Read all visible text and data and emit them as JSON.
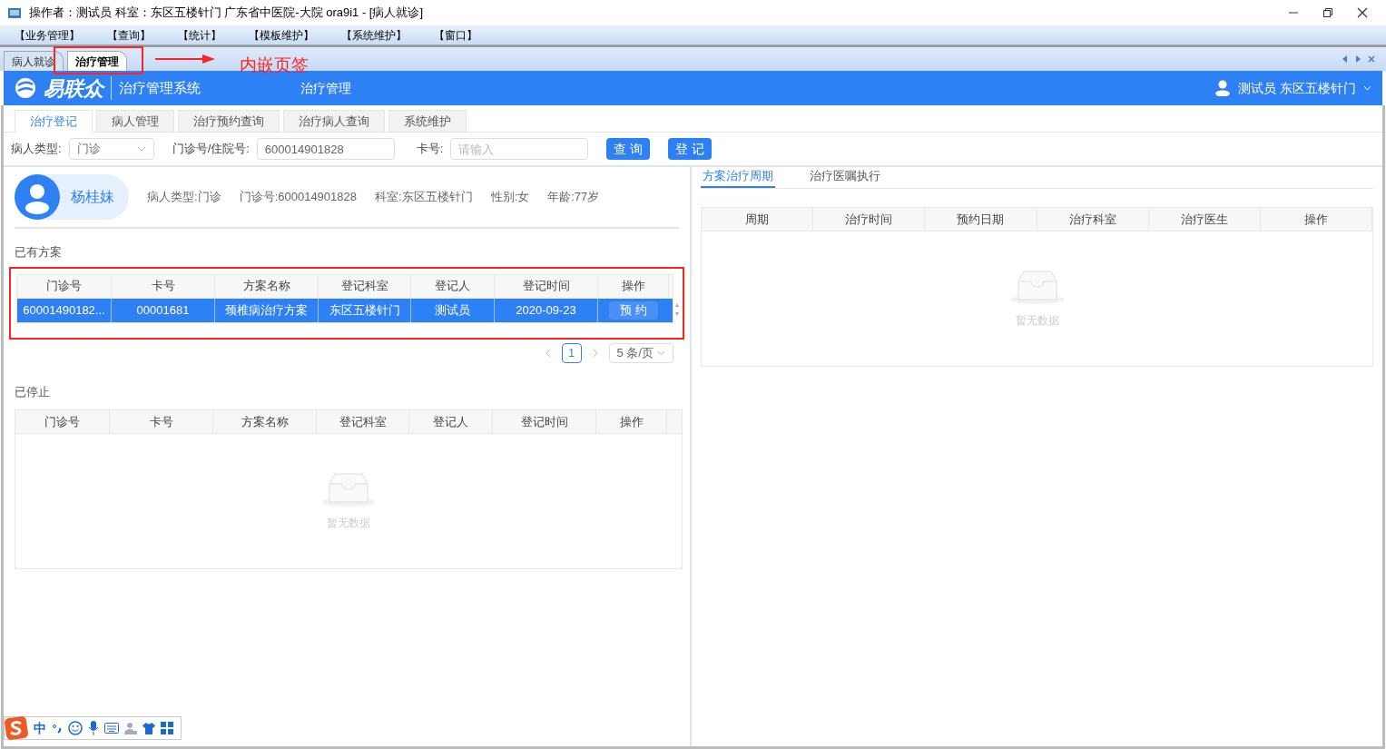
{
  "window": {
    "title": "操作者：测试员  科室：东区五楼针门  广东省中医院-大院 ora9i1 - [病人就诊]"
  },
  "menu": [
    "【业务管理】",
    "【查询】",
    "【统计】",
    "【模板维护】",
    "【系统维护】",
    "【窗口】"
  ],
  "doc_tabs": [
    {
      "label": "病人就诊",
      "selected": false
    },
    {
      "label": "治疗管理",
      "selected": true
    }
  ],
  "annotation": {
    "label": "内嵌页签"
  },
  "header": {
    "logo_text": "易联众",
    "system_name": "治疗管理系统",
    "page_title": "治疗管理",
    "user": "测试员 东区五楼针门"
  },
  "module_tabs": [
    {
      "label": "治疗登记",
      "selected": true
    },
    {
      "label": "病人管理",
      "selected": false
    },
    {
      "label": "治疗预约查询",
      "selected": false
    },
    {
      "label": "治疗病人查询",
      "selected": false
    },
    {
      "label": "系统维护",
      "selected": false
    }
  ],
  "search": {
    "patient_type": {
      "label": "病人类型:",
      "value": "门诊"
    },
    "number": {
      "label": "门诊号/住院号:",
      "value": "600014901828"
    },
    "card": {
      "label": "卡号:",
      "placeholder": "请输入"
    },
    "buttons": [
      "查 询",
      "登 记"
    ]
  },
  "patient": {
    "name": "杨桂妹",
    "info": [
      "病人类型:门诊",
      "门诊号:600014901828",
      "科室:东区五楼针门",
      "性别:女",
      "年龄:77岁"
    ]
  },
  "active_plans": {
    "title": "已有方案",
    "columns": [
      "门诊号",
      "卡号",
      "方案名称",
      "登记科室",
      "登记人",
      "登记时间",
      "操作"
    ],
    "rows": [
      {
        "selected": true,
        "cells": [
          "60001490182...",
          "00001681",
          "颈椎病治疗方案",
          "东区五楼针门",
          "测试员",
          "2020-09-23"
        ],
        "action": "预 约"
      }
    ],
    "pagination": {
      "page": "1",
      "page_size": "5 条/页"
    }
  },
  "stopped_plans": {
    "title": "已停止",
    "columns": [
      "门诊号",
      "卡号",
      "方案名称",
      "登记科室",
      "登记人",
      "登记时间",
      "操作"
    ],
    "empty_text": "暂无数据"
  },
  "right_panel": {
    "tabs": [
      {
        "label": "方案治疗周期",
        "selected": true
      },
      {
        "label": "治疗医嘱执行",
        "selected": false
      }
    ],
    "columns": [
      "周期",
      "治疗时间",
      "预约日期",
      "治疗科室",
      "治疗医生",
      "操作"
    ],
    "empty_text": "暂无数据"
  },
  "ime_toolbar": {
    "mode": "中"
  }
}
